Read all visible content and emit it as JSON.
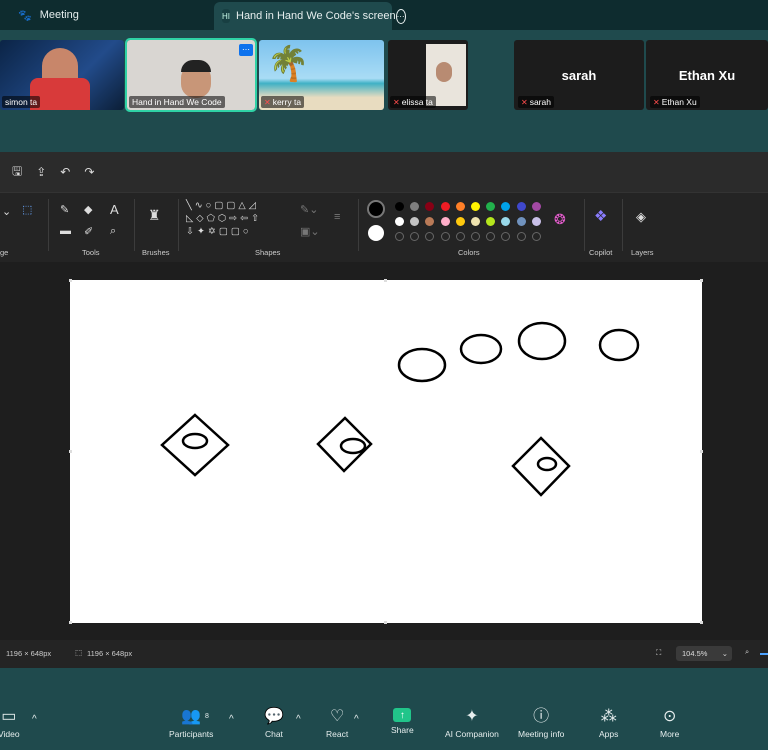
{
  "topbar": {
    "meeting_label": "Meeting",
    "screen_tab_initials": "HI",
    "screen_tab_title": "Hand in Hand We Code's screen"
  },
  "participants": [
    {
      "name": "simon ta",
      "muted": false
    },
    {
      "name": "Hand in Hand We Code",
      "muted": false,
      "active": true
    },
    {
      "name": "kerry ta",
      "muted": true
    },
    {
      "name": "elissa ta",
      "muted": true
    },
    {
      "name": "sarah",
      "muted": true,
      "camera_off": true
    },
    {
      "name": "Ethan Xu",
      "muted": true,
      "camera_off": true
    }
  ],
  "paint": {
    "groups": {
      "image": "ge",
      "tools": "Tools",
      "brushes": "Brushes",
      "shapes": "Shapes",
      "colors": "Colors",
      "copilot": "Copilot",
      "layers": "Layers"
    },
    "colors_row1": [
      "#000000",
      "#7f7f7f",
      "#880015",
      "#ed1c24",
      "#ff7f27",
      "#fff200",
      "#22b14c",
      "#00a2e8",
      "#3f48cc",
      "#a349a4"
    ],
    "colors_row2": [
      "#ffffff",
      "#c3c3c3",
      "#b97a57",
      "#ffaec9",
      "#ffc90e",
      "#efe4b0",
      "#b5e61d",
      "#99d9ea",
      "#7092be",
      "#c8bfe7"
    ],
    "status": {
      "size_label": "1196 × 648px",
      "selection_label": "1196 × 648px",
      "zoom": "104.5%"
    }
  },
  "bottom_toolbar": {
    "video": "Video",
    "participants": "Participants",
    "participants_count": "8",
    "chat": "Chat",
    "react": "React",
    "share": "Share",
    "ai": "AI Companion",
    "info": "Meeting info",
    "apps": "Apps",
    "more": "More"
  },
  "colors": {
    "meeting_bg": "#1f4a4d",
    "active_tile": "#2fd2a6",
    "share_green": "#21c58a"
  }
}
